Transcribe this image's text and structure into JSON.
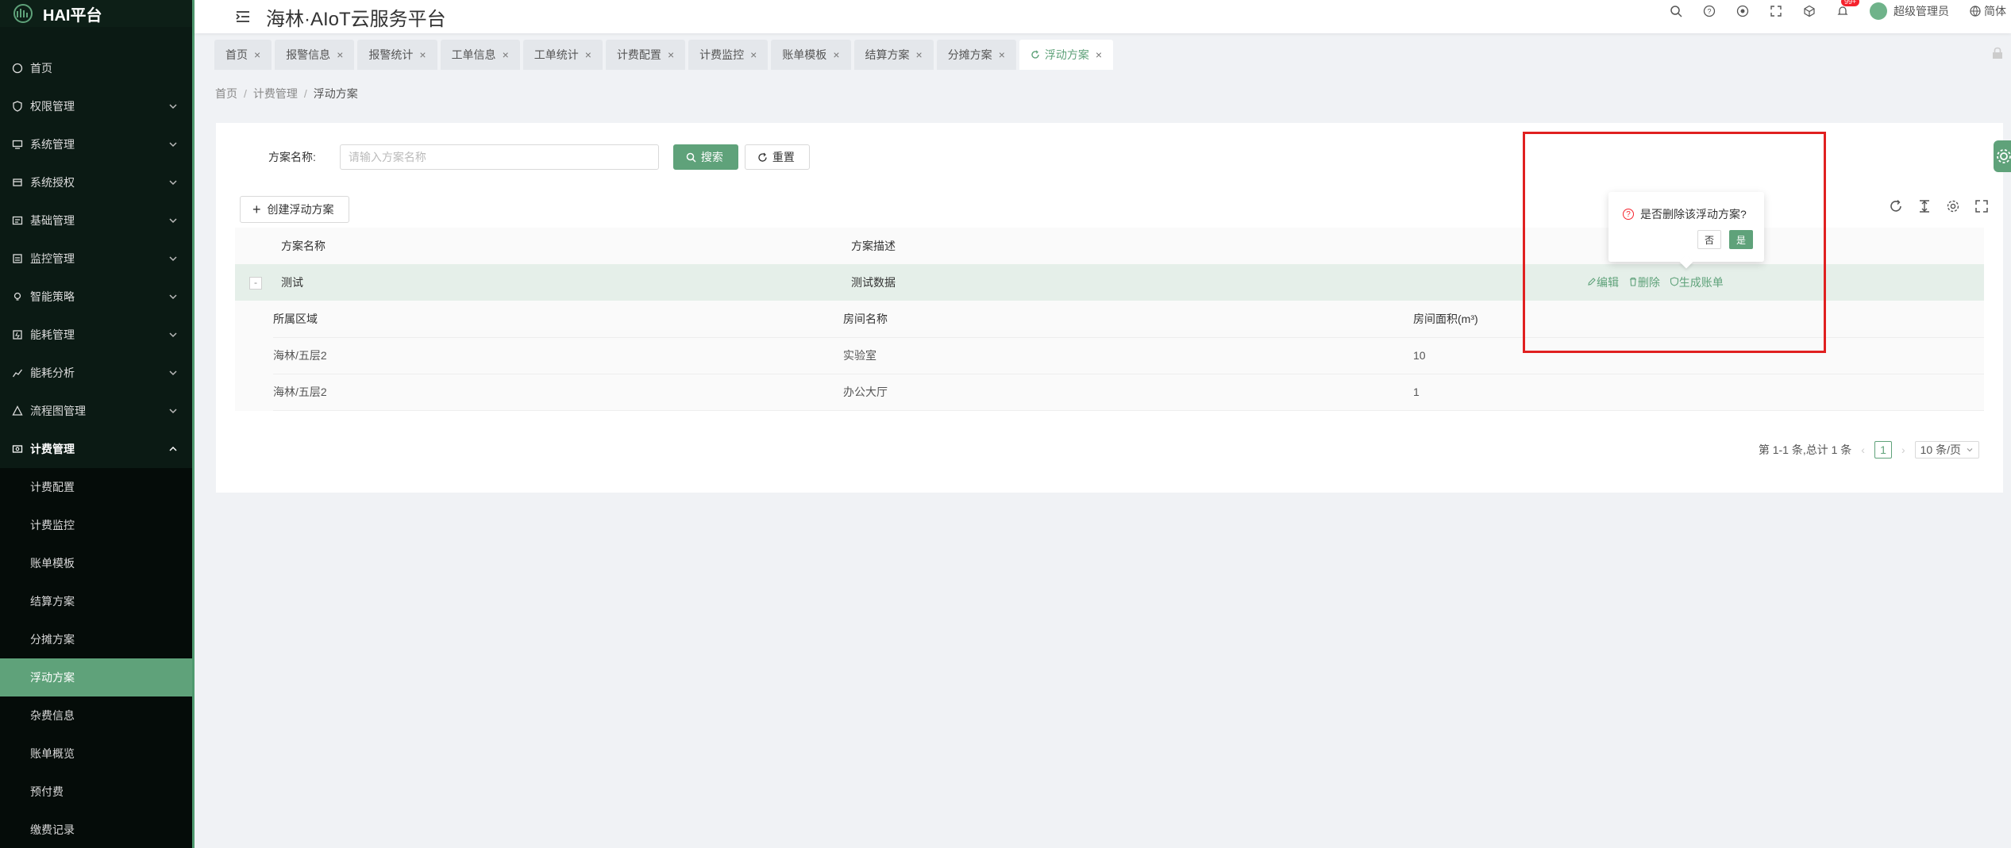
{
  "app": {
    "logo_text": "HAI平台",
    "title": "海林·AIoT云服务平台"
  },
  "sidebar": {
    "items": [
      {
        "label": "首页",
        "icon": "home-icon"
      },
      {
        "label": "权限管理",
        "icon": "shield-icon"
      },
      {
        "label": "系统管理",
        "icon": "monitor-icon"
      },
      {
        "label": "系统授权",
        "icon": "key-icon"
      },
      {
        "label": "基础管理",
        "icon": "grid-icon"
      },
      {
        "label": "监控管理",
        "icon": "camera-icon"
      },
      {
        "label": "智能策略",
        "icon": "bulb-icon"
      },
      {
        "label": "能耗管理",
        "icon": "energy-icon"
      },
      {
        "label": "能耗分析",
        "icon": "chart-icon"
      },
      {
        "label": "流程图管理",
        "icon": "flow-icon"
      },
      {
        "label": "计费管理",
        "icon": "billing-icon"
      }
    ],
    "sub_items": [
      "计费配置",
      "计费监控",
      "账单模板",
      "结算方案",
      "分摊方案",
      "浮动方案",
      "杂费信息",
      "账单概览",
      "预付费",
      "缴费记录"
    ]
  },
  "header": {
    "user": "超级管理员",
    "lang": "简体",
    "badge": "99+"
  },
  "tabs": [
    "首页",
    "报警信息",
    "报警统计",
    "工单信息",
    "工单统计",
    "计费配置",
    "计费监控",
    "账单模板",
    "结算方案",
    "分摊方案",
    "浮动方案"
  ],
  "breadcrumb": {
    "home": "首页",
    "parent": "计费管理",
    "current": "浮动方案"
  },
  "search": {
    "label": "方案名称:",
    "placeholder": "请输入方案名称",
    "search_btn": "搜索",
    "reset_btn": "重置"
  },
  "toolbar": {
    "create_btn": "创建浮动方案"
  },
  "table": {
    "headers": [
      "方案名称",
      "方案描述"
    ],
    "rows": [
      {
        "name": "测试",
        "desc": "测试数据",
        "expand": "-"
      }
    ],
    "actions": {
      "edit": "编辑",
      "delete": "删除",
      "bill": "生成账单"
    },
    "sub_headers": [
      "所属区域",
      "房间名称",
      "房间面积(m³)"
    ],
    "sub_rows": [
      {
        "area": "海林/五层2",
        "room": "实验室",
        "size": "10"
      },
      {
        "area": "海林/五层2",
        "room": "办公大厅",
        "size": "1"
      }
    ]
  },
  "pagination": {
    "summary": "第 1-1 条,总计 1 条",
    "page": "1",
    "page_size": "10 条/页"
  },
  "popconfirm": {
    "message": "是否删除该浮动方案?",
    "no": "否",
    "yes": "是"
  },
  "colors": {
    "accent": "#5fa27a",
    "sidebar_bg": "#0b1a14",
    "highlight": "#e02020"
  }
}
